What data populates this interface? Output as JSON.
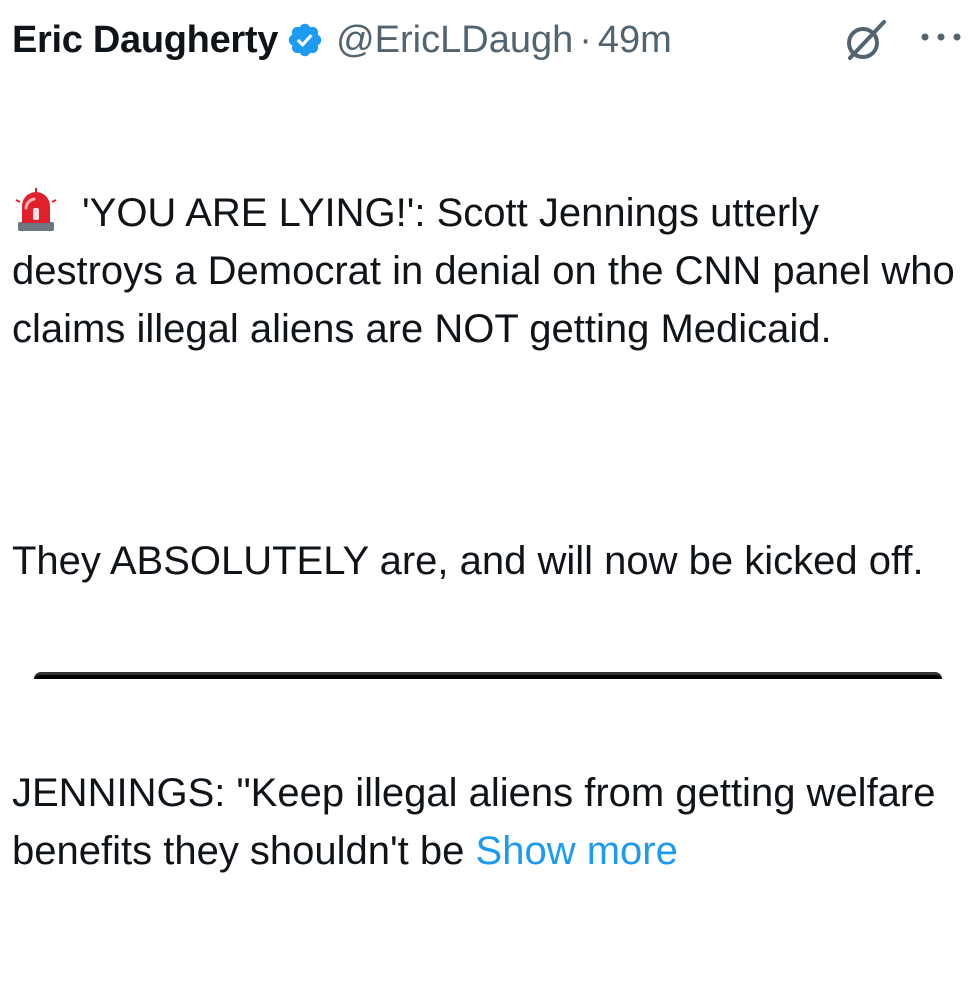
{
  "tweet": {
    "author_name": "Eric Daugherty",
    "handle": "@EricLDaugh",
    "separator": "·",
    "time": "49m",
    "emoji_icon": "police-car-light-icon",
    "paragraph1": "'YOU ARE LYING!': Scott Jennings utterly destroys a Democrat in denial on the CNN panel who claims illegal aliens are NOT getting Medicaid.",
    "paragraph2": "They ABSOLUTELY are, and will now be kicked off.",
    "paragraph3": "JENNINGS: \"Keep illegal aliens from getting welfare benefits they shouldn't be ",
    "show_more": "Show more"
  },
  "colors": {
    "text": "#0f1419",
    "secondary": "#536471",
    "link": "#1d9bf0",
    "verified": "#1d9bf0"
  }
}
